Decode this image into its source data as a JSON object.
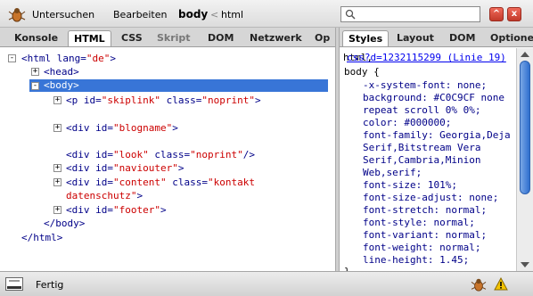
{
  "toolbar": {
    "inspect_label": "Untersuchen",
    "edit_label": "Bearbeiten",
    "breadcrumb": {
      "current": "body",
      "separator": "<",
      "parent": "html"
    },
    "search": {
      "value": "",
      "placeholder": ""
    },
    "minimize_glyph": "^",
    "close_glyph": "x"
  },
  "left_tabs": [
    "Konsole",
    "HTML",
    "CSS",
    "Skript",
    "DOM",
    "Netzwerk",
    "Op"
  ],
  "right_tabs": [
    "Styles",
    "Layout",
    "DOM",
    "Optione"
  ],
  "html_tree": {
    "line1": {
      "open": "<html",
      "attr": "lang=",
      "val": "\"de\"",
      "close": ">"
    },
    "line2": "<head>",
    "line3": "<body>",
    "line4": {
      "open": "<p",
      "attr1": "id=",
      "val1": "\"skiplink\"",
      "attr2": "class=",
      "val2": "\"noprint\"",
      "close": ">"
    },
    "line5": {
      "open": "<div",
      "attr": "id=",
      "val": "\"blogname\"",
      "close": ">"
    },
    "line6": {
      "open": "<div",
      "attr1": "id=",
      "val1": "\"look\"",
      "attr2": "class=",
      "val2": "\"noprint\"",
      "close": "/>"
    },
    "line7": {
      "open": "<div",
      "attr": "id=",
      "val": "\"naviouter\"",
      "close": ">"
    },
    "line8": {
      "open": "<div",
      "attr1": "id=",
      "val1": "\"content\"",
      "attr2": "class=",
      "val2": "\"kontakt",
      "cont": "datenschutz\"",
      "close": ">"
    },
    "line9": {
      "open": "<div",
      "attr": "id=",
      "val": "\"footer\"",
      "close": ">"
    },
    "line10": "</body>",
    "line11": "</html>"
  },
  "css_panel": {
    "source_link": "css?d=1232115299 (Linie 19)",
    "overlap_text": "html,",
    "selector": "body {",
    "lines": [
      "-x-system-font: none;",
      "background: #C0C9CF none",
      "repeat scroll 0% 0%;",
      "color: #000000;",
      "font-family: Georgia,Deja",
      "Serif,Bitstream Vera",
      "Serif,Cambria,Minion",
      "Web,serif;",
      "font-size: 101%;",
      "font-size-adjust: none;",
      "font-stretch: normal;",
      "font-style: normal;",
      "font-variant: normal;",
      "font-weight: normal;",
      "line-height: 1.45;"
    ],
    "closing": "}"
  },
  "status": {
    "text": "Fertig"
  },
  "colors": {
    "selection": "#3875d7",
    "tag": "#000088",
    "value": "#cc0000"
  },
  "icons": [
    "firebug-icon",
    "search-icon",
    "minimize-icon",
    "close-icon",
    "layout-icon",
    "firebug-status-icon",
    "warning-icon"
  ]
}
